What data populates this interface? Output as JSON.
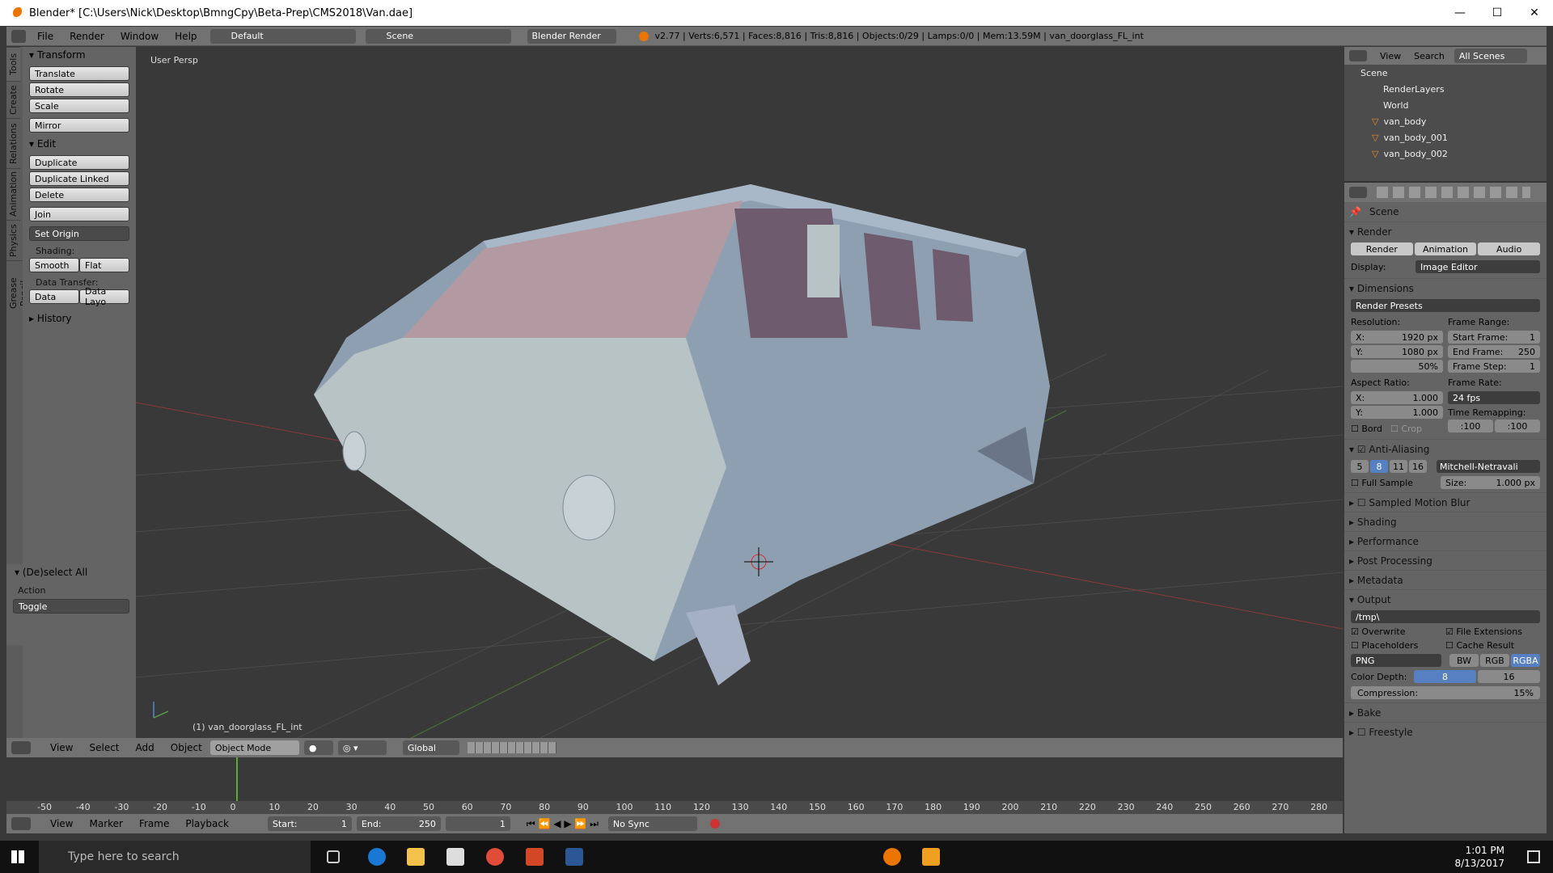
{
  "window": {
    "title": "Blender* [C:\\Users\\Nick\\Desktop\\BmngCpy\\Beta-Prep\\CMS2018\\Van.dae]",
    "min": "—",
    "max": "☐",
    "close": "✕"
  },
  "info": {
    "menus": [
      "File",
      "Render",
      "Window",
      "Help"
    ],
    "layout": "Default",
    "scene": "Scene",
    "engine": "Blender Render",
    "stats": "v2.77 | Verts:6,571 | Faces:8,816 | Tris:8,816 | Objects:0/29 | Lamps:0/0 | Mem:13.59M | van_doorglass_FL_int"
  },
  "tabs": [
    "Tools",
    "Create",
    "Relations",
    "Animation",
    "Physics",
    "Grease Pencil"
  ],
  "toolshelf": {
    "transform": "Transform",
    "translate": "Translate",
    "rotate": "Rotate",
    "scale": "Scale",
    "mirror": "Mirror",
    "edit": "Edit",
    "duplicate": "Duplicate",
    "duplicate_linked": "Duplicate Linked",
    "delete": "Delete",
    "join": "Join",
    "set_origin": "Set Origin",
    "shading": "Shading:",
    "smooth": "Smooth",
    "flat": "Flat",
    "data_transfer": "Data Transfer:",
    "data": "Data",
    "data_layout": "Data Layo",
    "history": "History",
    "deselect": "(De)select All",
    "action": "Action",
    "toggle": "Toggle"
  },
  "viewport": {
    "label": "User Persp",
    "object": "(1) van_doorglass_FL_int"
  },
  "view3d_header": {
    "items": [
      "View",
      "Select",
      "Add",
      "Object"
    ],
    "mode": "Object Mode",
    "orientation": "Global"
  },
  "timeline": {
    "items": [
      "View",
      "Marker",
      "Frame",
      "Playback"
    ],
    "start": "Start:",
    "start_val": "1",
    "end": "End:",
    "end_val": "250",
    "current": "1",
    "sync": "No Sync",
    "ticks": [
      "-50",
      "-40",
      "-30",
      "-20",
      "-10",
      "0",
      "10",
      "20",
      "30",
      "40",
      "50",
      "60",
      "70",
      "80",
      "90",
      "100",
      "110",
      "120",
      "130",
      "140",
      "150",
      "160",
      "170",
      "180",
      "190",
      "200",
      "210",
      "220",
      "230",
      "240",
      "250",
      "260",
      "270",
      "280"
    ]
  },
  "outliner": {
    "view": "View",
    "search": "Search",
    "filter": "All Scenes",
    "items": [
      "Scene",
      "RenderLayers",
      "World",
      "van_body",
      "van_body_001",
      "van_body_002"
    ]
  },
  "properties": {
    "scene": "Scene",
    "render": "Render",
    "render_btn": "Render",
    "animation_btn": "Animation",
    "audio_btn": "Audio",
    "display": "Display:",
    "display_val": "Image Editor",
    "dimensions": "Dimensions",
    "presets": "Render Presets",
    "resolution": "Resolution:",
    "res_x": "X:",
    "res_x_val": "1920 px",
    "res_y": "Y:",
    "res_y_val": "1080 px",
    "res_pct": "50%",
    "frame_range": "Frame Range:",
    "start_frame": "Start Frame:",
    "start_frame_val": "1",
    "end_frame": "End Frame:",
    "end_frame_val": "250",
    "frame_step": "Frame Step:",
    "frame_step_val": "1",
    "aspect": "Aspect Ratio:",
    "asp_x": "X:",
    "asp_x_val": "1.000",
    "asp_y": "Y:",
    "asp_y_val": "1.000",
    "frame_rate": "Frame Rate:",
    "fps": "24 fps",
    "time_remap": "Time Remapping:",
    "remap_old": ":100",
    "remap_new": ":100",
    "bord": "Bord",
    "crop": "Crop",
    "aa": "Anti-Aliasing",
    "aa_samples": [
      "5",
      "8",
      "11",
      "16"
    ],
    "filter": "Mitchell-Netravali",
    "full_sample": "Full Sample",
    "size": "Size:",
    "size_val": "1.000 px",
    "sections": [
      "Sampled Motion Blur",
      "Shading",
      "Performance",
      "Post Processing",
      "Metadata"
    ],
    "output": "Output",
    "path": "/tmp\\",
    "overwrite": "Overwrite",
    "file_ext": "File Extensions",
    "placeholders": "Placeholders",
    "cache": "Cache Result",
    "format": "PNG",
    "bw": "BW",
    "rgb": "RGB",
    "rgba": "RGBA",
    "color_depth": "Color Depth:",
    "depth_8": "8",
    "depth_16": "16",
    "compression": "Compression:",
    "compression_val": "15%",
    "bake": "Bake",
    "freestyle": "Freestyle"
  },
  "taskbar": {
    "search": "Type here to search",
    "time": "1:01 PM",
    "date": "8/13/2017"
  }
}
